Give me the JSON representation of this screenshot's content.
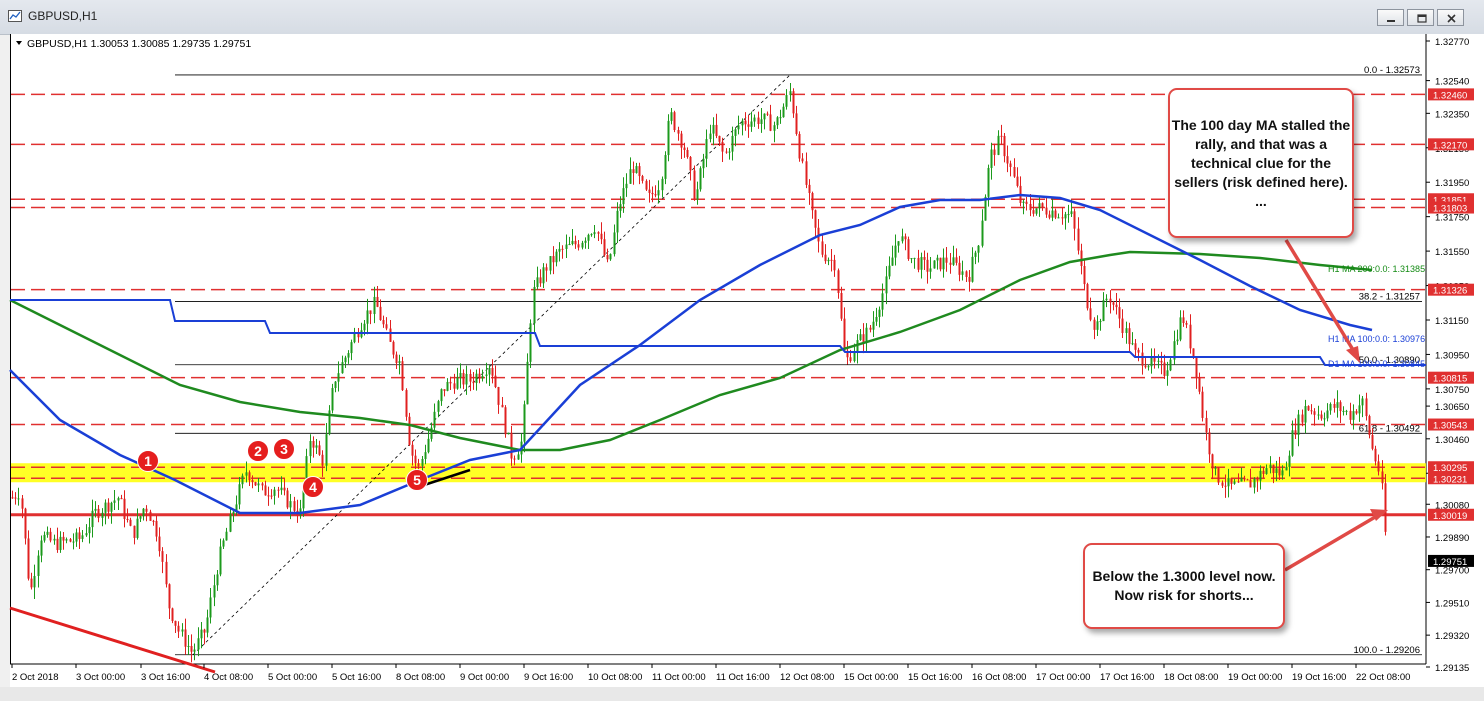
{
  "window": {
    "title": "GBPUSD,H1",
    "buttons": [
      "minimize",
      "restore",
      "close"
    ]
  },
  "header": {
    "symbol_line": "GBPUSD,H1  1.30053 1.30085 1.29735 1.29751"
  },
  "chart_data": {
    "type": "candlestick",
    "symbol": "GBPUSD",
    "timeframe": "H1",
    "ohlc_last": {
      "open": 1.30053,
      "high": 1.30085,
      "low": 1.29735,
      "close": 1.29751
    },
    "y_axis": {
      "range": [
        1.29135,
        1.3277
      ],
      "ticks": [
        "1.32770",
        "1.32540",
        "1.32350",
        "1.32150",
        "1.31950",
        "1.31750",
        "1.31550",
        "1.31350",
        "1.31150",
        "1.30950",
        "1.30750",
        "1.30650",
        "1.30460",
        "1.30260",
        "1.30080",
        "1.29890",
        "1.29700",
        "1.29510",
        "1.29320",
        "1.29135"
      ]
    },
    "x_axis": {
      "ticks": [
        "2 Oct 2018",
        "3 Oct 00:00",
        "3 Oct 16:00",
        "4 Oct 08:00",
        "5 Oct 00:00",
        "5 Oct 16:00",
        "8 Oct 08:00",
        "9 Oct 00:00",
        "9 Oct 16:00",
        "10 Oct 08:00",
        "11 Oct 00:00",
        "11 Oct 16:00",
        "12 Oct 08:00",
        "15 Oct 00:00",
        "15 Oct 16:00",
        "16 Oct 08:00",
        "17 Oct 00:00",
        "17 Oct 16:00",
        "18 Oct 08:00",
        "19 Oct 00:00",
        "19 Oct 16:00",
        "22 Oct 08:00"
      ]
    },
    "horizontal_levels": [
      {
        "label": "1.32460",
        "value": 1.3246,
        "color": "#e03030"
      },
      {
        "label": "1.32170",
        "value": 1.3217,
        "color": "#e03030"
      },
      {
        "label": "1.31851",
        "value": 1.31851,
        "color": "#e03030"
      },
      {
        "label": "1.31803",
        "value": 1.31803,
        "color": "#e03030"
      },
      {
        "label": "1.31326",
        "value": 1.31326,
        "color": "#e03030"
      },
      {
        "label": "1.30815",
        "value": 1.30815,
        "color": "#e03030"
      },
      {
        "label": "1.30543",
        "value": 1.30543,
        "color": "#e03030"
      },
      {
        "label": "1.30295",
        "value": 1.30295,
        "color": "#e03030"
      },
      {
        "label": "1.30231",
        "value": 1.30231,
        "color": "#e03030"
      },
      {
        "label": "1.30019",
        "value": 1.30019,
        "color": "#e03030"
      }
    ],
    "fibonacci": [
      {
        "label": "0.0 - 1.32573",
        "value": 1.32573
      },
      {
        "label": "38.2 - 1.31257",
        "value": 1.31257
      },
      {
        "label": "50.0 - 1.30890",
        "value": 1.3089
      },
      {
        "label": "61.8 - 1.30492",
        "value": 1.30492
      },
      {
        "label": "100.0 - 1.29206",
        "value": 1.29206
      }
    ],
    "moving_average_labels": [
      {
        "label": "H1 MA 200:0.0: 1.31385",
        "value": 1.31385,
        "color": "#138a13"
      },
      {
        "label": "H1 MA 100:0.0: 1.30976",
        "value": 1.30976,
        "color": "#1a3fd6"
      },
      {
        "label": "D1 MA 100:0.0: 1.30845",
        "value": 1.30845,
        "color": "#1a3fd6"
      }
    ],
    "current_price_label": "1.29751",
    "current_price": 1.29751,
    "support_zone": {
      "from": 1.30231,
      "to": 1.30295,
      "color": "#ffff00"
    },
    "markers": [
      "1",
      "2",
      "3",
      "4",
      "5"
    ]
  },
  "annotations": {
    "callout_top": "The 100 day MA stalled the rally, and that was a technical clue for the sellers (risk defined here). ...",
    "callout_bottom": "Below the 1.3000 level now.  Now risk for shorts..."
  },
  "colors": {
    "bull": "#1c9a1c",
    "bear": "#e02020",
    "ma_blue": "#1a3fd6",
    "ma_green": "#1f8a1f",
    "level_red": "#e03030",
    "zone_yellow": "#ffff00"
  }
}
